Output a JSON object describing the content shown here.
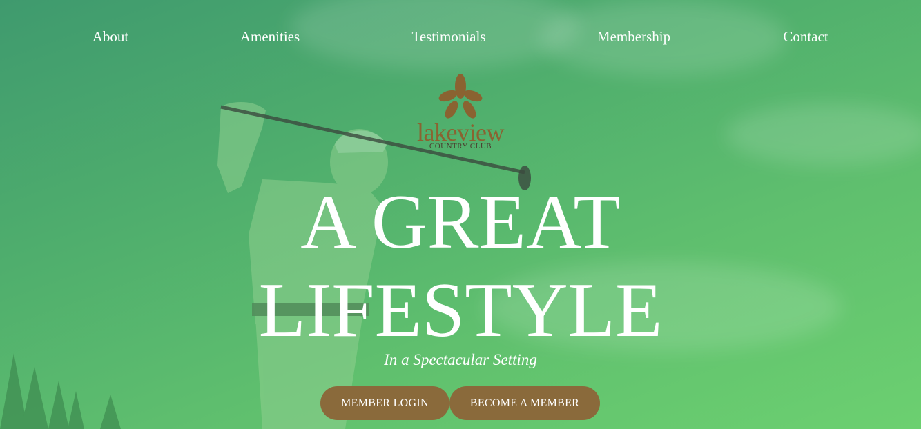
{
  "nav": {
    "items": [
      {
        "label": "About"
      },
      {
        "label": "Amenities"
      },
      {
        "label": "Testimonials"
      },
      {
        "label": "Membership"
      },
      {
        "label": "Contact"
      }
    ]
  },
  "logo": {
    "name": "lakeview",
    "subtitle": "COUNTRY CLUB",
    "icon": "flower-icon",
    "color": "#8a6331"
  },
  "hero": {
    "headline_line1": "A GREAT",
    "headline_line2": "LIFESTYLE",
    "tagline": "In a Spectacular Setting",
    "overlay_color": "#5cb86e"
  },
  "buttons": {
    "member_login": "MEMBER LOGIN",
    "become_member": "BECOME A MEMBER",
    "color": "#8a6a3b"
  }
}
